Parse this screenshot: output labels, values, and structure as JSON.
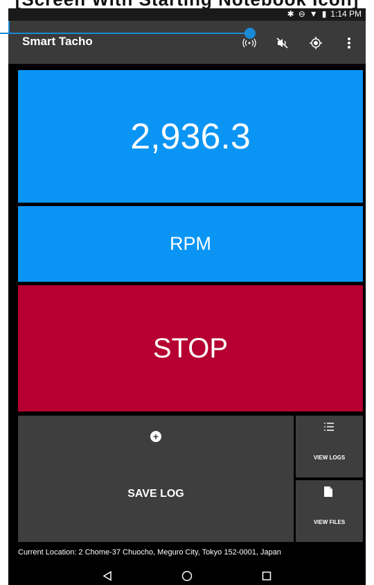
{
  "overlay": {
    "caption": "[Screen With Starting Notebook Icon]"
  },
  "status": {
    "time": "1:14 PM"
  },
  "appbar": {
    "title": "Smart Tacho",
    "icons": [
      "broadcast-icon",
      "mute-icon",
      "gps-target-icon",
      "overflow-menu-icon"
    ]
  },
  "main": {
    "rpm_value": "2,936.3",
    "rpm_unit": "RPM",
    "stop_label": "STOP",
    "save_log_label": "SAVE LOG",
    "view_logs_label": "VIEW LOGS",
    "view_files_label": "VIEW FILES"
  },
  "footer": {
    "location": "Current Location: 2 Chome-37 Chuocho, Meguro City, Tokyo 152-0001, Japan"
  },
  "colors": {
    "accent_blue": "#0a95f5",
    "stop_red": "#b50031",
    "tile_gray": "#3e3e3e",
    "callout_blue": "#1a8ad4"
  }
}
